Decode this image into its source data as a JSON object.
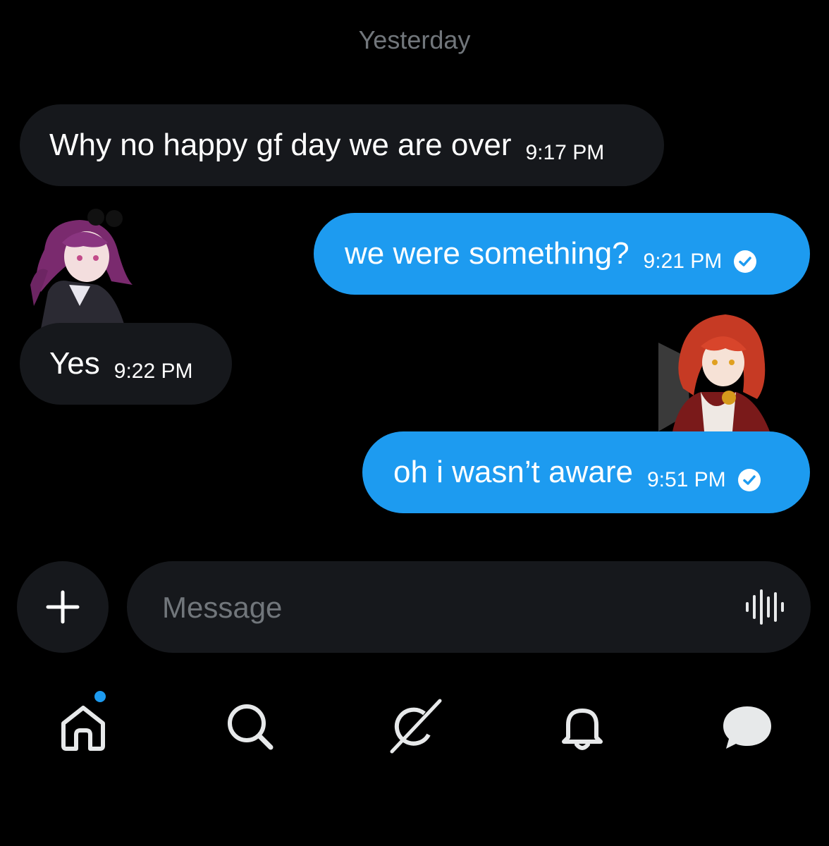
{
  "conversation": {
    "date_separator": "Yesterday",
    "messages": [
      {
        "direction": "received",
        "text": "Why no happy gf day we are over",
        "time": "9:17 PM"
      },
      {
        "direction": "sent",
        "text": "we were something?",
        "time": "9:21 PM",
        "status_icon": "check-circle-icon"
      },
      {
        "direction": "received",
        "text": "Yes",
        "time": "9:22 PM"
      },
      {
        "direction": "sent",
        "text": "oh i wasn’t aware",
        "time": "9:51 PM",
        "status_icon": "check-circle-icon"
      }
    ]
  },
  "composer": {
    "placeholder": "Message",
    "add_icon": "plus-icon",
    "voice_icon": "voice-waveform-icon"
  },
  "navbar": {
    "items": [
      {
        "icon": "home-icon",
        "has_notification_dot": true
      },
      {
        "icon": "search-icon"
      },
      {
        "icon": "grok-icon"
      },
      {
        "icon": "bell-icon"
      },
      {
        "icon": "messages-icon"
      }
    ]
  },
  "colors": {
    "background": "#000000",
    "received_bubble": "#16181c",
    "sent_bubble": "#1d9bf0",
    "muted_text": "#71767b",
    "accent": "#1d9bf0"
  }
}
